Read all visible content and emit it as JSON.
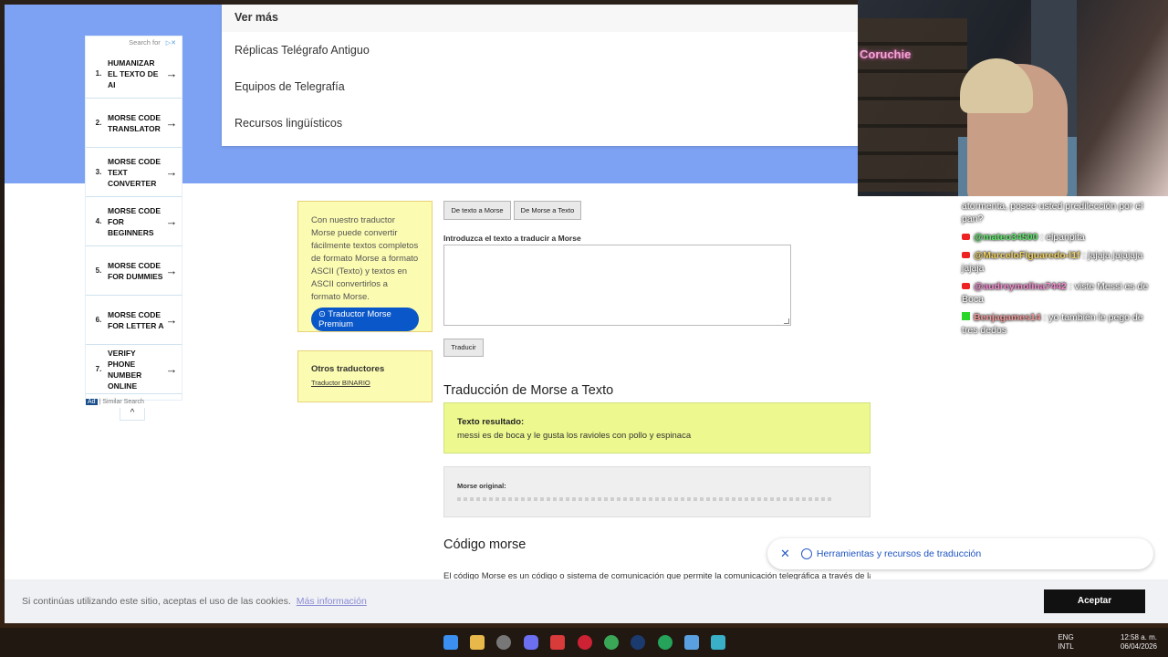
{
  "menu": {
    "header": "Ver más",
    "items": [
      "Réplicas Telégrafo Antiguo",
      "Equipos de Telegrafía",
      "Recursos lingüísticos"
    ]
  },
  "ad": {
    "search_for": "Search for",
    "items": [
      {
        "num": "1.",
        "text": "HUMANIZAR EL TEXTO DE AI"
      },
      {
        "num": "2.",
        "text": "MORSE CODE TRANSLATOR"
      },
      {
        "num": "3.",
        "text": "MORSE CODE TEXT CONVERTER"
      },
      {
        "num": "4.",
        "text": "MORSE CODE FOR BEGINNERS"
      },
      {
        "num": "5.",
        "text": "MORSE CODE FOR DUMMIES"
      },
      {
        "num": "6.",
        "text": "MORSE CODE FOR LETTER A"
      },
      {
        "num": "7.",
        "text": "VERIFY PHONE NUMBER ONLINE"
      }
    ],
    "badge": "Ad",
    "footer": "| Similar Search",
    "collapse": "^"
  },
  "info": {
    "text": "Con nuestro traductor Morse puede convertir fácilmente textos completos de formato Morse a formato ASCII (Texto) y textos en ASCII convertirlos a formato Morse.",
    "premium": "⊙ Traductor Morse Premium"
  },
  "others": {
    "title": "Otros traductores",
    "link": "Traductor BINARIO"
  },
  "translator": {
    "tab1": "De texto a Morse",
    "tab2": "De Morse a Texto",
    "input_label": "Introduzca el texto a traducir a Morse",
    "button": "Traducir"
  },
  "result": {
    "heading": "Traducción de Morse a Texto",
    "label": "Texto resultado:",
    "value": "messi es de boca y le gusta los ravioles con pollo y espinaca",
    "original_label": "Morse original:"
  },
  "section": {
    "heading": "Código morse",
    "paragraph": "El código Morse es un código o sistema de comunicación que permite la comunicación telegráfica a través de la"
  },
  "tools": {
    "close": "✕",
    "label": "Herramientas y recursos de traducción"
  },
  "cookie": {
    "message": "Si continúas utilizando este sitio, aceptas el uso de las cookies.",
    "link": "Más información",
    "accept": "Aceptar"
  },
  "webcam": {
    "sign": "Coruchie"
  },
  "chat": [
    {
      "user": "",
      "text": "atormenta, posee usted predilección por el pan?"
    },
    {
      "user": "@mateo34500",
      "text": " : elpanpita"
    },
    {
      "user": "@MarceloFiguaredo-l1f",
      "text": " : jajaja jajajaja jajaja"
    },
    {
      "user": "@audreymolina7442",
      "text": " : viste Messi es de Boca"
    },
    {
      "user": "Benjagames14",
      "text": " : yo también le pego de tres dedos"
    }
  ],
  "taskbar": {
    "lang1": "ENG",
    "lang2": "INTL",
    "time": "12:58 a. m.",
    "date": "06/04/2026"
  }
}
